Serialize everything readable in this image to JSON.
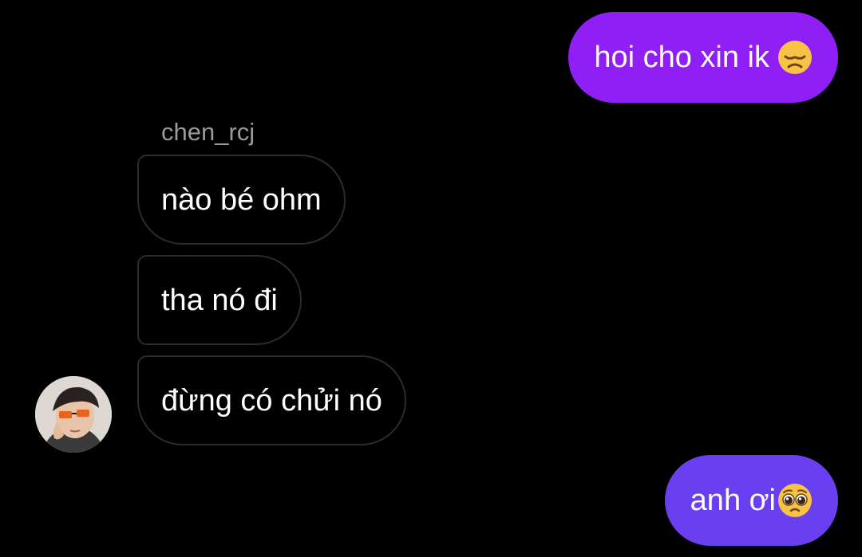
{
  "conversation": {
    "messages": [
      {
        "direction": "outgoing",
        "text": "hoi cho xin ik",
        "emoji": "disappointed-face"
      },
      {
        "direction": "incoming",
        "text": "nào bé ohm"
      },
      {
        "direction": "incoming",
        "text": "tha nó đi"
      },
      {
        "direction": "incoming",
        "text": "đừng có chửi nó"
      },
      {
        "direction": "outgoing",
        "text": "anh ơi",
        "emoji": "pleading-face"
      }
    ],
    "incoming_sender": "chen_rcj"
  },
  "colors": {
    "background": "#000000",
    "outgoing_top": "#8f1ff4",
    "outgoing_bottom": "#6a3ff0",
    "incoming_border": "#2b2b2b",
    "sender_name": "#9a9a9a"
  },
  "icons": [
    "disappointed-face-emoji",
    "pleading-face-emoji",
    "avatar"
  ]
}
